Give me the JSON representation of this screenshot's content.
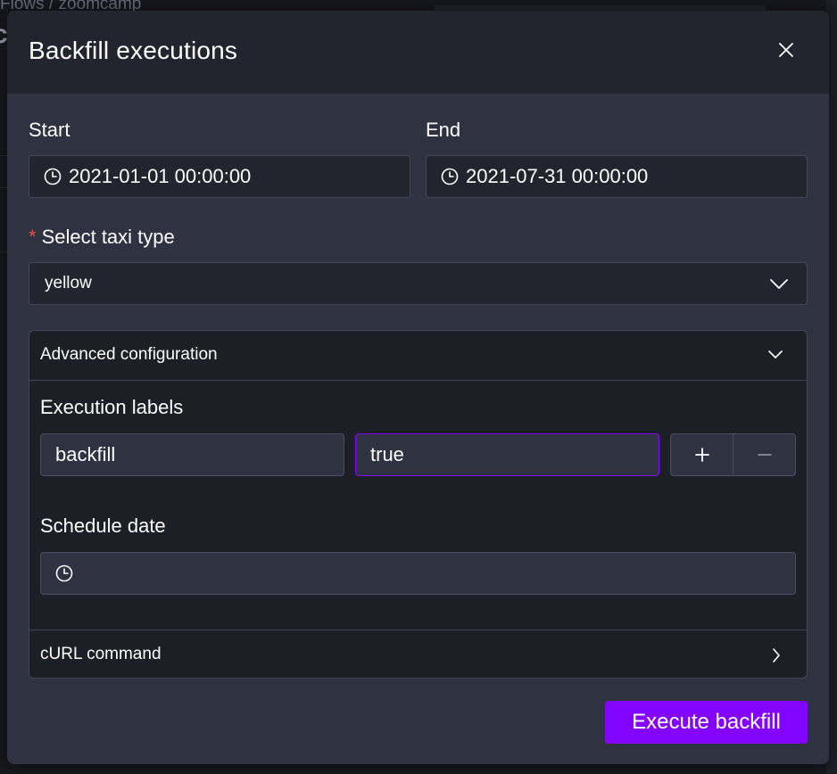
{
  "background": {
    "breadcrumb": "Flows  /  zoomcamp",
    "title_fragment": "c"
  },
  "modal": {
    "title": "Backfill executions",
    "start": {
      "label": "Start",
      "value": "2021-01-01 00:00:00"
    },
    "end": {
      "label": "End",
      "value": "2021-07-31 00:00:00"
    },
    "taxi_type": {
      "required_mark": "*",
      "label": "Select taxi type",
      "value": "yellow"
    },
    "advanced": {
      "title": "Advanced configuration",
      "execution_labels": {
        "label": "Execution labels",
        "key": "backfill",
        "value": "true"
      },
      "schedule_date": {
        "label": "Schedule date",
        "value": ""
      }
    },
    "curl": {
      "title": "cURL command"
    },
    "execute_label": "Execute backfill"
  },
  "colors": {
    "accent": "#8405ff",
    "required": "#e0524a",
    "panel": "#2f3240",
    "header": "#22242e"
  },
  "icons": [
    "close-icon",
    "clock-icon",
    "chevron-down-icon",
    "chevron-right-icon",
    "plus-icon",
    "minus-icon"
  ]
}
